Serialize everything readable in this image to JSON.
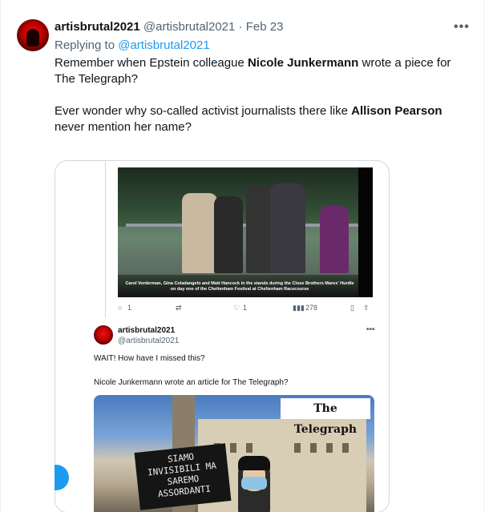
{
  "tweet": {
    "display_name": "artisbrutal2021",
    "handle": "@artisbrutal2021",
    "separator": "·",
    "date": "Feb 23",
    "more_label": "•••",
    "replying_prefix": "Replying to",
    "replying_handle": "@artisbrutal2021",
    "p1_a": "Remember when Epstein colleague ",
    "p1_bold": "Nicole Junkermann",
    "p1_b": " wrote a piece for The Telegraph?",
    "p2_a": "Ever wonder why so-called activist journalists there like ",
    "p2_bold": "Allison Pearson",
    "p2_b": " never mention her name?"
  },
  "screenshot": {
    "caption": "Carol Vorderman, Gina Coladangelo and Matt Hancock in the stands during the Close Brothers Mares' Hurdle on day one of the Cheltenham Festival at Cheltenham Racecourse",
    "actions": {
      "reply_count": "1",
      "retweet_count": "",
      "like_count": "1",
      "view_count": "278"
    },
    "quote": {
      "display_name": "artisbrutal2021",
      "handle": "@artisbrutal2021",
      "more_label": "•••",
      "text1": "WAIT! How have I missed this?",
      "text2": "Nicole Junkermann wrote an article for The Telegraph?",
      "masthead": "The Telegraph",
      "sign_text": "SIAMO INVISIBILI MA SAREMO ASSORDANTI"
    }
  },
  "colors": {
    "accent": "#1d9bf0",
    "secondary_text": "#536471",
    "primary_text": "#0f1419",
    "border": "#cfd9de"
  }
}
